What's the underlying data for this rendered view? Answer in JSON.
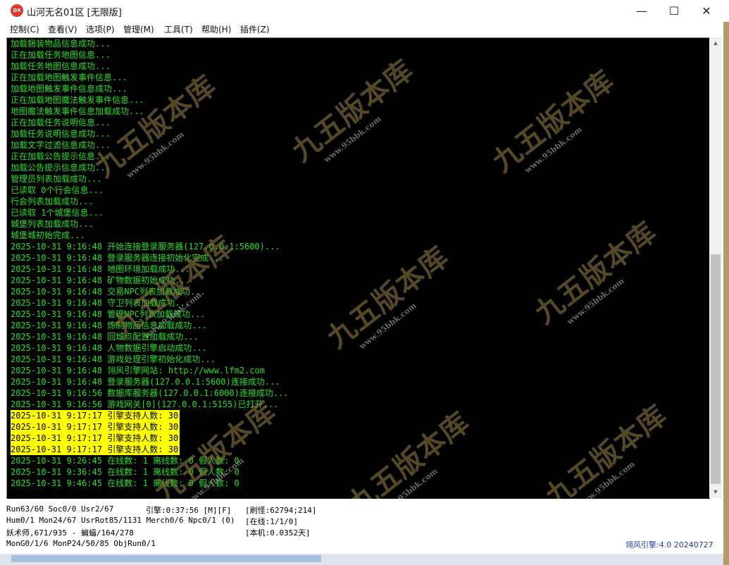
{
  "window": {
    "icon_text": "DX",
    "title": "山河无名01区 [无限版]",
    "minimize": "—",
    "maximize": "☐",
    "close": "✕"
  },
  "menu": [
    "控制(C)",
    "查看(V)",
    "选项(P)",
    "管理(M)",
    "工具(T)",
    "帮助(H)",
    "插件(Z)"
  ],
  "log": [
    {
      "text": "加载捆装物品信息成功...",
      "hl": false
    },
    {
      "text": "正在加载任务地图信息...",
      "hl": false
    },
    {
      "text": "加载任务地图信息成功...",
      "hl": false
    },
    {
      "text": "正在加载地图触发事件信息...",
      "hl": false
    },
    {
      "text": "加载地图触发事件信息成功...",
      "hl": false
    },
    {
      "text": "正在加载地图魔法触发事件信息...",
      "hl": false
    },
    {
      "text": "地图魔法触发事件信息加载成功...",
      "hl": false
    },
    {
      "text": "正在加载任务说明信息...",
      "hl": false
    },
    {
      "text": "加载任务说明信息成功...",
      "hl": false
    },
    {
      "text": "加载文字过滤信息成功...",
      "hl": false
    },
    {
      "text": "正在加载公告提示信息...",
      "hl": false
    },
    {
      "text": "加载公告提示信息成功...",
      "hl": false
    },
    {
      "text": "管理员列表加载成功...",
      "hl": false
    },
    {
      "text": "已读取 0个行会信息...",
      "hl": false
    },
    {
      "text": "行会列表加载成功...",
      "hl": false
    },
    {
      "text": "已读取 1个城堡信息...",
      "hl": false
    },
    {
      "text": "城堡列表加载成功...",
      "hl": false
    },
    {
      "text": "城堡城初始完成...",
      "hl": false
    },
    {
      "text": "2025-10-31 9:16:48 开始连接登录服务器(127.0.0.1:5600)...",
      "hl": false
    },
    {
      "text": "2025-10-31 9:16:48 登录服务器连接初始化完成...",
      "hl": false
    },
    {
      "text": "2025-10-31 9:16:48 地图环境加载成功...",
      "hl": false
    },
    {
      "text": "2025-10-31 9:16:48 矿物数据初始成功...",
      "hl": false
    },
    {
      "text": "2025-10-31 9:16:48 交易NPC列表加载成功...",
      "hl": false
    },
    {
      "text": "2025-10-31 9:16:48 守卫列表加载成功...",
      "hl": false
    },
    {
      "text": "2025-10-31 9:16:48 管理NPC列表加载成功...",
      "hl": false
    },
    {
      "text": "2025-10-31 9:16:48 炼制物品信息加载成功...",
      "hl": false
    },
    {
      "text": "2025-10-31 9:16:48 回城点配置加载成功...",
      "hl": false
    },
    {
      "text": "2025-10-31 9:16:48 人物数据引擎启动成功...",
      "hl": false
    },
    {
      "text": "2025-10-31 9:16:48 游戏处理引擎初始化成功...",
      "hl": false
    },
    {
      "text": "2025-10-31 9:16:48 翎风引擎网站: http://www.lfm2.com",
      "hl": false
    },
    {
      "text": "2025-10-31 9:16:48 登录服务器(127.0.0.1:5600)连接成功...",
      "hl": false
    },
    {
      "text": "2025-10-31 9:16:56 数据库服务器(127.0.0.1:6000)连接成功...",
      "hl": false
    },
    {
      "text": "2025-10-31 9:16:56 游戏网关[0](127.0.0.1:5155)已打开...",
      "hl": false
    },
    {
      "text": "2025-10-31 9:17:17 引擎支持人数: 30",
      "hl": true
    },
    {
      "text": "2025-10-31 9:17:17 引擎支持人数: 30",
      "hl": true
    },
    {
      "text": "2025-10-31 9:17:17 引擎支持人数: 30",
      "hl": true
    },
    {
      "text": "2025-10-31 9:17:17 引擎支持人数: 30",
      "hl": true
    },
    {
      "text": "2025-10-31 9:26:45 在线数: 1 离线数: 0 假人数: 0",
      "hl": false
    },
    {
      "text": "2025-10-31 9:36:45 在线数: 1 离线数: 0 假人数: 0",
      "hl": false
    },
    {
      "text": "2025-10-31 9:46:45 在线数: 1 离线数: 0 假人数: 0",
      "hl": false
    }
  ],
  "watermark": {
    "big": "九五版本库",
    "small": "www.95bbk.com"
  },
  "status": {
    "r1c1": "Run63/60 Soc0/0 Usr2/67",
    "r1c2": "引擎:0:37:56 [M][F]",
    "r1c3": "[刷怪:62794;214]",
    "r2c1": "Hum0/1 Mon24/67 UsrRot85/1131 Merch0/6 Npc0/1 (0)",
    "r2c3": "[在线:1/1/0]",
    "r3c1": "妖术师,671/935 - 蝙蝠/164/278",
    "r3c3": "[本机:0.0352天]",
    "r4c1": "MonG0/1/6 MonP24/50/85 ObjRun0/1",
    "version": "翎风引擎:4.0 20240727"
  },
  "colors": {
    "log_green": "#22e022",
    "highlight": "#ffff00",
    "console_bg": "#000000"
  }
}
